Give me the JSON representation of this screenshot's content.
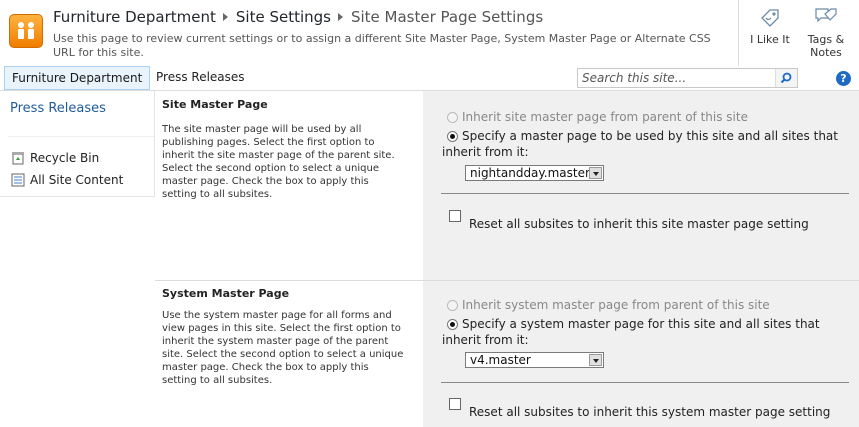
{
  "header": {
    "breadcrumb": [
      "Furniture Department",
      "Site Settings",
      "Site Master Page Settings"
    ],
    "description": "Use this page to review current settings or to assign a different Site Master Page, System Master Page or Alternate CSS URL for this site.",
    "i_like_it": "I Like It",
    "tags_notes": "Tags & Notes"
  },
  "nav": {
    "tabs": [
      {
        "label": "Furniture Department",
        "selected": true
      },
      {
        "label": "Press Releases",
        "selected": false
      }
    ],
    "search_placeholder": "Search this site...",
    "help": "?"
  },
  "quick_launch": {
    "heading": "Press Releases",
    "links": [
      "Recycle Bin",
      "All Site Content"
    ]
  },
  "sections": [
    {
      "title": "Site Master Page",
      "description": "The site master page will be used by all publishing pages. Select the first option to inherit the site master page of the parent site. Select the second option to select a unique master page. Check the box to apply this setting to all subsites.",
      "option_inherit": "Inherit site master page from parent of this site",
      "option_specify": "Specify a master page to be used by this site and all sites that inherit from it:",
      "selected_master": "nightandday.master",
      "reset_label": "Reset all subsites to inherit this site master page setting"
    },
    {
      "title": "System Master Page",
      "description": "Use the system master page for all forms and view pages in this site. Select the first option to inherit the system master page of the parent site. Select the second option to select a unique master page. Check the box to apply this setting to all subsites.",
      "option_inherit": "Inherit system master page from parent of this site",
      "option_specify": "Specify a system master page for this site and all sites that inherit from it:",
      "selected_master": "v4.master",
      "reset_label": "Reset all subsites to inherit this system master page setting"
    }
  ],
  "colors": {
    "accent": "#1f5a9e",
    "logo": "#f07d00",
    "panel": "#f0f0f0"
  }
}
